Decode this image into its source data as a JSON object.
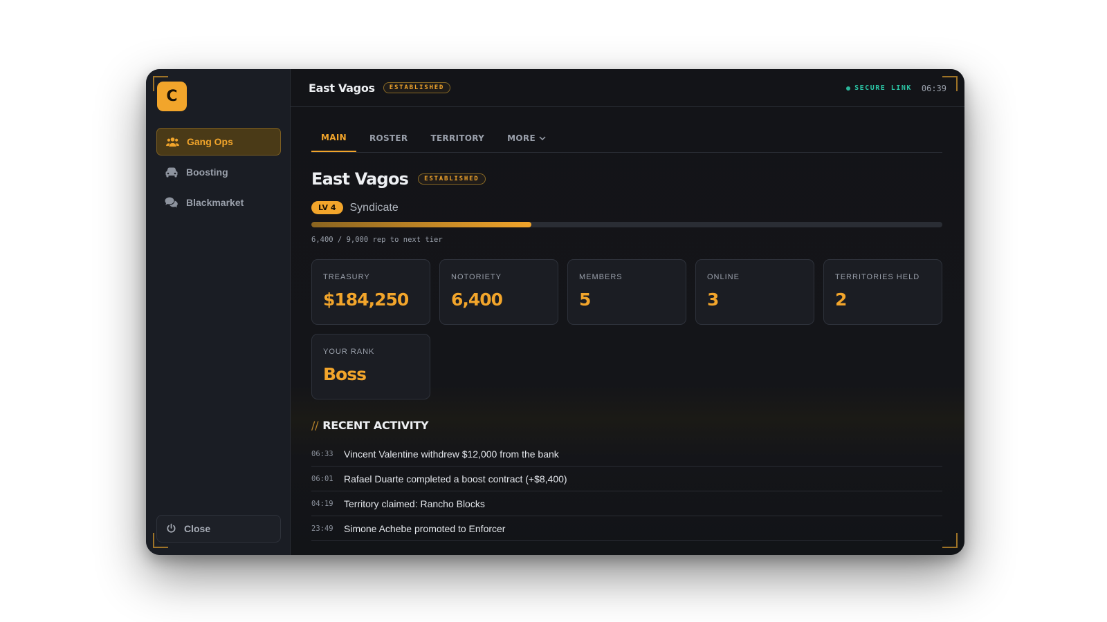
{
  "logo": {
    "letter": "C"
  },
  "sidebar": {
    "items": [
      {
        "label": "Gang Ops",
        "icon": "users-icon",
        "active": true
      },
      {
        "label": "Boosting",
        "icon": "car-icon",
        "active": false
      },
      {
        "label": "Blackmarket",
        "icon": "chat-bubbles-icon",
        "active": false
      }
    ],
    "close_label": "Close"
  },
  "topbar": {
    "title": "East Vagos",
    "badge": "ESTABLISHED",
    "secure_label": "SECURE LINK",
    "time": "06:39"
  },
  "tabs": [
    {
      "label": "MAIN",
      "active": true
    },
    {
      "label": "ROSTER",
      "active": false
    },
    {
      "label": "TERRITORY",
      "active": false
    },
    {
      "label": "MORE",
      "active": false
    }
  ],
  "gang": {
    "name": "East Vagos",
    "badge": "ESTABLISHED",
    "level": "LV 4",
    "tier": "Syndicate",
    "rep_current": 6400,
    "rep_target": 9000,
    "rep_text": "6,400 / 9,000 rep to next tier"
  },
  "stats": [
    {
      "label": "TREASURY",
      "value": "$184,250"
    },
    {
      "label": "NOTORIETY",
      "value": "6,400"
    },
    {
      "label": "MEMBERS",
      "value": "5"
    },
    {
      "label": "ONLINE",
      "value": "3"
    },
    {
      "label": "TERRITORIES HELD",
      "value": "2"
    },
    {
      "label": "YOUR RANK",
      "value": "Boss"
    }
  ],
  "activity": {
    "slashes": "//",
    "title": "RECENT ACTIVITY",
    "items": [
      {
        "time": "06:33",
        "text": "Vincent Valentine withdrew $12,000 from the bank"
      },
      {
        "time": "06:01",
        "text": "Rafael Duarte completed a boost contract (+$8,400)"
      },
      {
        "time": "04:19",
        "text": "Territory claimed: Rancho Blocks"
      },
      {
        "time": "23:49",
        "text": "Simone Achebe promoted to Enforcer"
      }
    ]
  },
  "colors": {
    "accent": "#f2a52b",
    "secure": "#2bc4a4",
    "bg": "#131418",
    "sidebar": "#1a1d24"
  }
}
